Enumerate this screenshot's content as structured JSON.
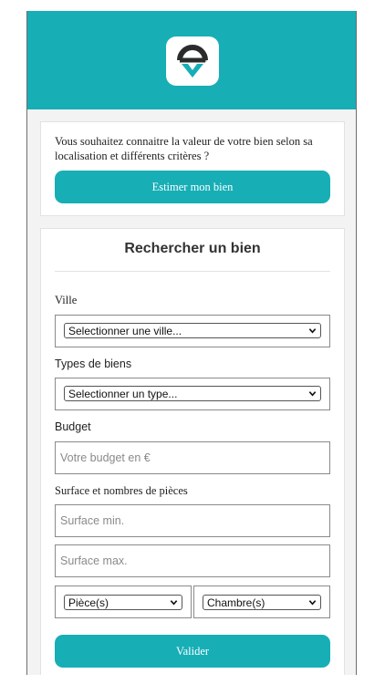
{
  "estimate": {
    "intro": "Vous souhaitez connaitre la valeur de votre bien selon sa localisation et différents critères ?",
    "button": "Estimer mon bien"
  },
  "search": {
    "title": "Rechercher un bien",
    "city_label": "Ville",
    "city_select": "Selectionner une ville...",
    "type_label": "Types de biens",
    "type_select": "Selectionner un type...",
    "budget_label": "Budget",
    "budget_placeholder": "Votre budget en €",
    "surface_label": "Surface et nombres de pièces",
    "surface_min_placeholder": "Surface min.",
    "surface_max_placeholder": "Surface max.",
    "rooms_select": "Pièce(s)",
    "bedrooms_select": "Chambre(s)",
    "validate_button": "Valider"
  },
  "colors": {
    "brand": "#17aeb6",
    "logo_dark": "#2b2b2b"
  },
  "icons": {
    "logo": "location-pin-logo-icon",
    "dropdown": "chevron-down-icon"
  }
}
